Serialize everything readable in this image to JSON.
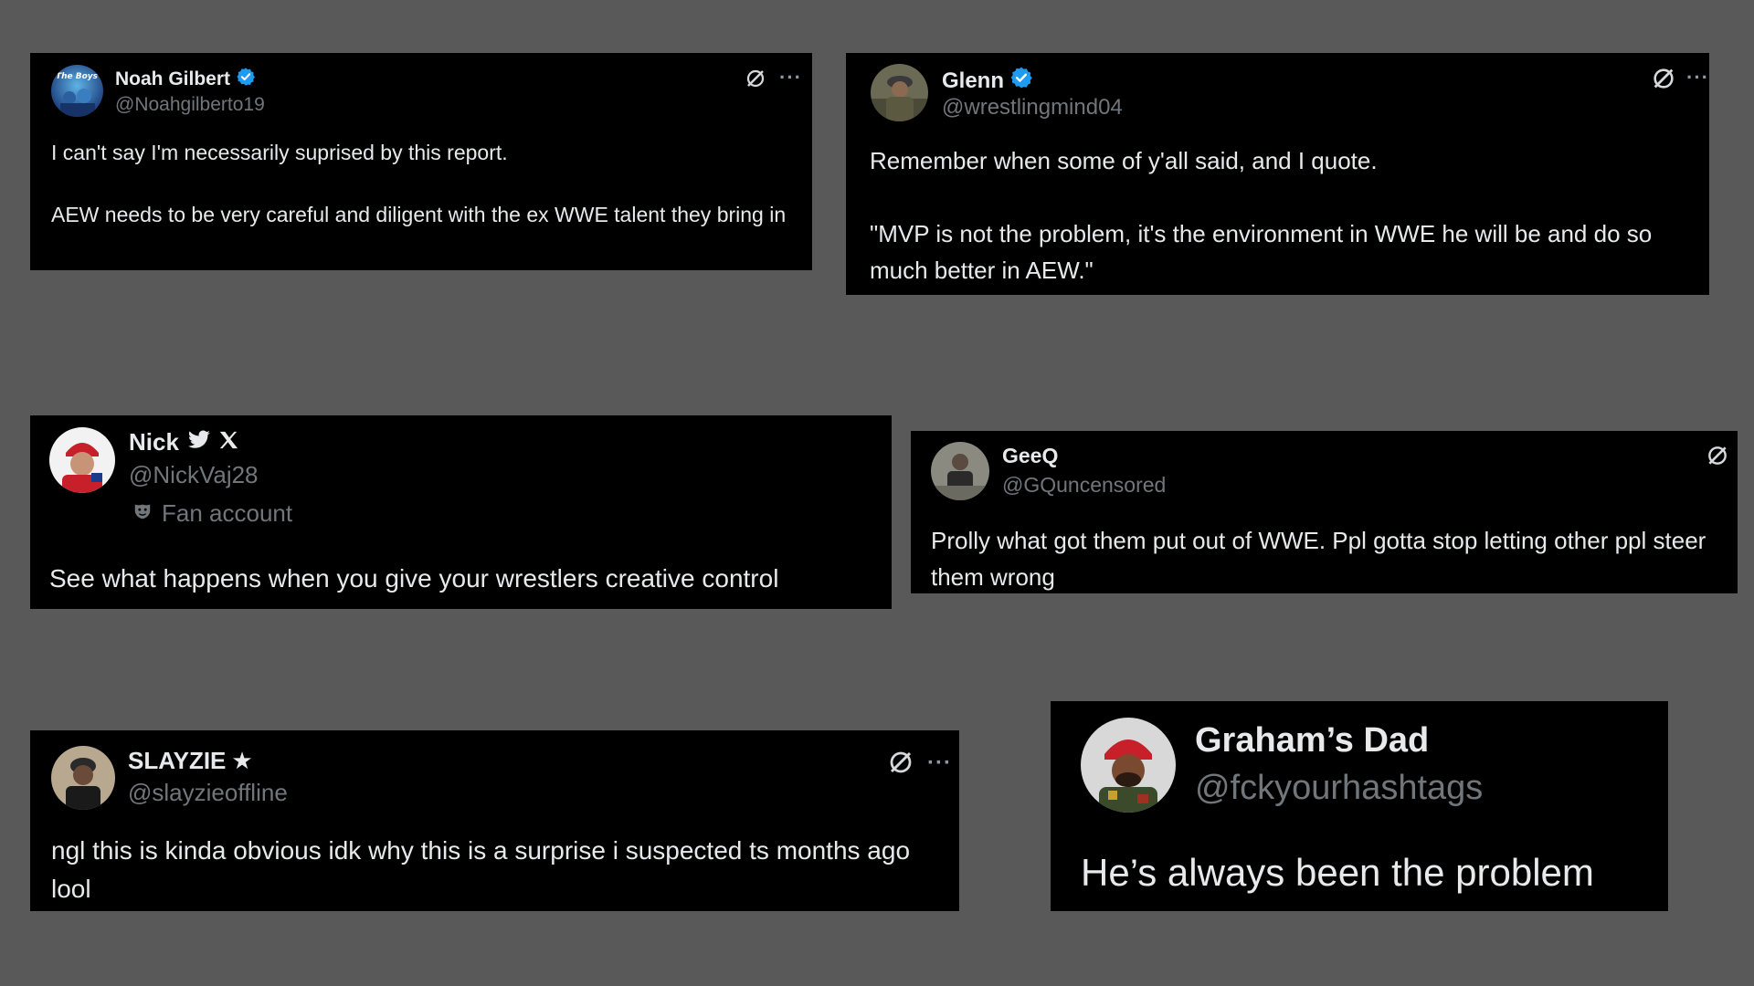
{
  "colors": {
    "page_background": "#595959",
    "card_background": "#000000",
    "primary_text": "#e7e9ea",
    "secondary_text": "#71767b",
    "verified_blue": "#1d9bf0"
  },
  "tweets": [
    {
      "name": "Noah Gilbert",
      "handle": "@Noahgilberto19",
      "badge": "verified-badge-icon",
      "text": "I can't say I'm necessarily suprised by this report.\n\nAEW needs to be very careful and diligent with the ex WWE talent they bring in",
      "avatar": "avatar-image",
      "actions": [
        "grok-icon",
        "more-icon"
      ]
    },
    {
      "name": "Glenn",
      "handle": "@wrestlingmind04",
      "badge": "verified-badge-icon",
      "text": "Remember when some of y'all said, and I quote.\n\n\"MVP is not the problem, it's the environment in WWE he will be and do so much better in AEW.\"",
      "avatar": "avatar-image",
      "actions": [
        "grok-icon",
        "more-icon"
      ]
    },
    {
      "name": "Nick",
      "handle": "@NickVaj28",
      "badges": [
        "bird-icon",
        "x-logo-icon"
      ],
      "fan_label": "Fan account",
      "text": "See what happens when you give your wrestlers creative control",
      "avatar": "avatar-image"
    },
    {
      "name": "GeeQ",
      "handle": "@GQuncensored",
      "text": "Prolly what got them put out of WWE. Ppl gotta stop letting other ppl steer them wrong",
      "avatar": "avatar-image",
      "actions": [
        "grok-icon"
      ]
    },
    {
      "name": "SLAYZIE",
      "name_suffix": "★",
      "handle": "@slayzieoffline",
      "text": "ngl this is kinda obvious idk why this is a surprise i suspected ts months ago lool",
      "avatar": "avatar-image",
      "actions": [
        "grok-icon",
        "more-icon"
      ]
    },
    {
      "name": "Graham’s Dad",
      "handle": "@fckyourhashtags",
      "text": "He’s always been the problem",
      "avatar": "avatar-image"
    }
  ],
  "more_glyph": "···"
}
